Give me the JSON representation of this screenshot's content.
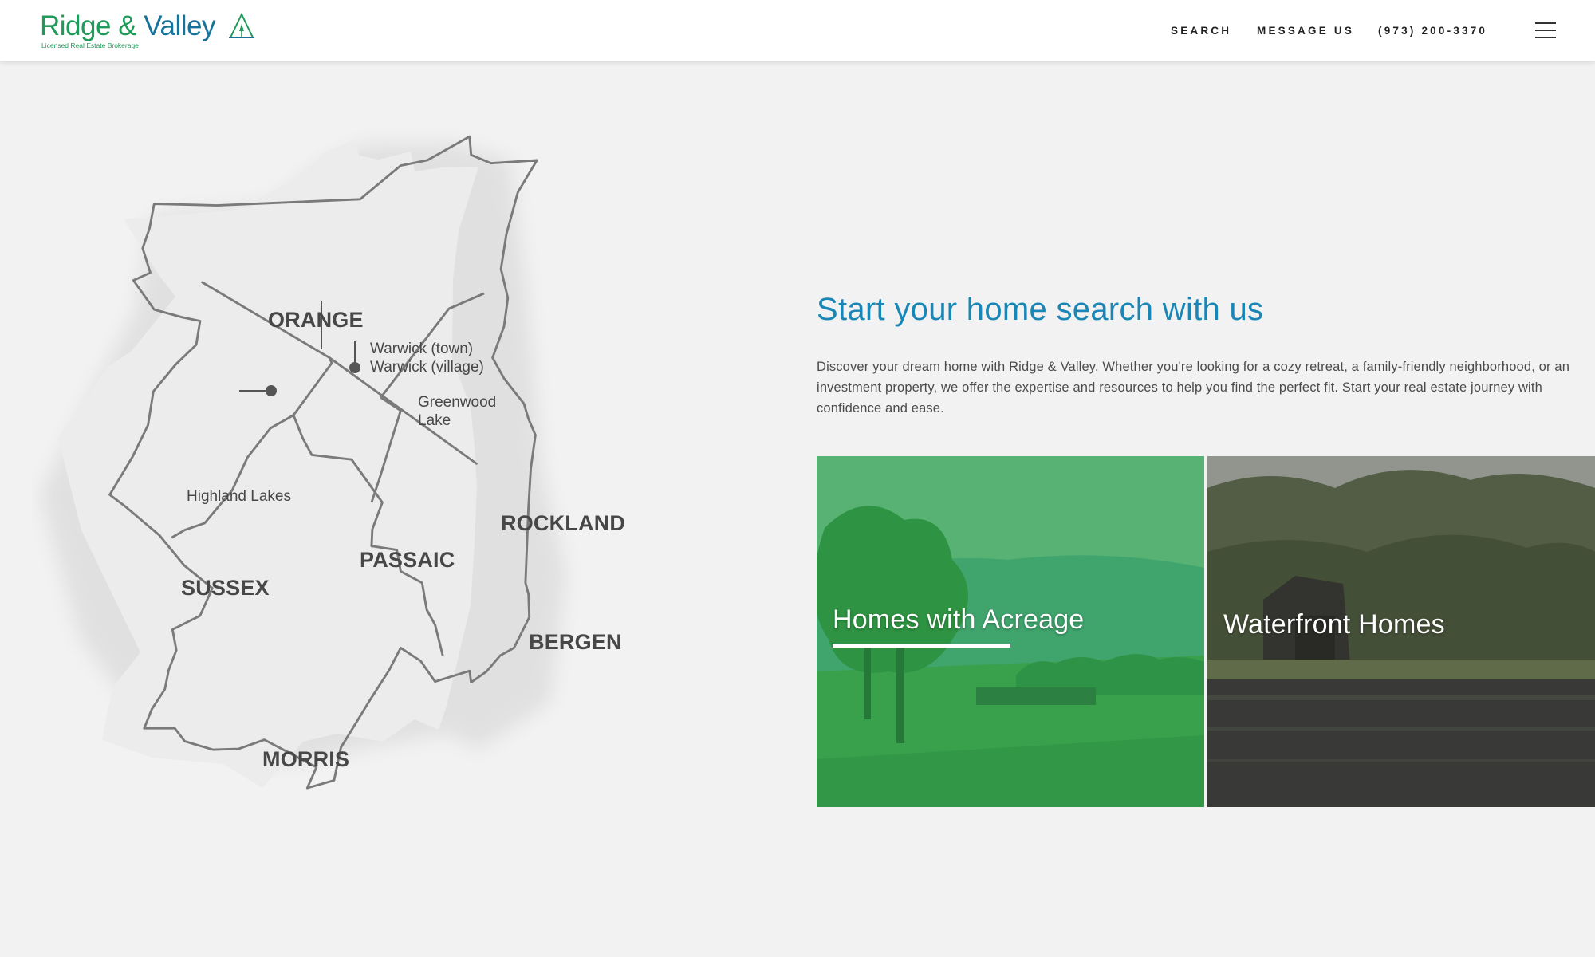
{
  "brand": {
    "name_part1": "Ridge",
    "name_amp": "&",
    "name_part2": "Valley",
    "tagline": "Licensed Real Estate Brokerage",
    "colors": {
      "green": "#1e9b58",
      "blue": "#17729a"
    }
  },
  "nav": {
    "search": "SEARCH",
    "message": "MESSAGE US",
    "phone": "(973) 200-3370",
    "menu_icon": "hamburger-menu-icon"
  },
  "map": {
    "counties": {
      "orange": "ORANGE",
      "sussex": "SUSSEX",
      "passaic": "PASSAIC",
      "rockland": "ROCKLAND",
      "bergen": "BERGEN",
      "morris": "MORRIS"
    },
    "places": {
      "warwick_town": "Warwick (town)",
      "warwick_village": "Warwick (village)",
      "greenwood_1": "Greenwood",
      "greenwood_2": "Lake",
      "highland_lakes": "Highland Lakes"
    }
  },
  "main": {
    "headline": "Start your home search with us",
    "intro": "Discover your dream home with Ridge & Valley. Whether you're looking for a cozy retreat, a family-friendly neighborhood, or an investment property, we offer the expertise and resources to help you find the perfect fit. Start your real estate journey with confidence and ease.",
    "cards": [
      {
        "title": "Homes with Acreage",
        "overlay_color": "#2fa452",
        "active": true
      },
      {
        "title": "Waterfront Homes",
        "active": false
      }
    ]
  }
}
